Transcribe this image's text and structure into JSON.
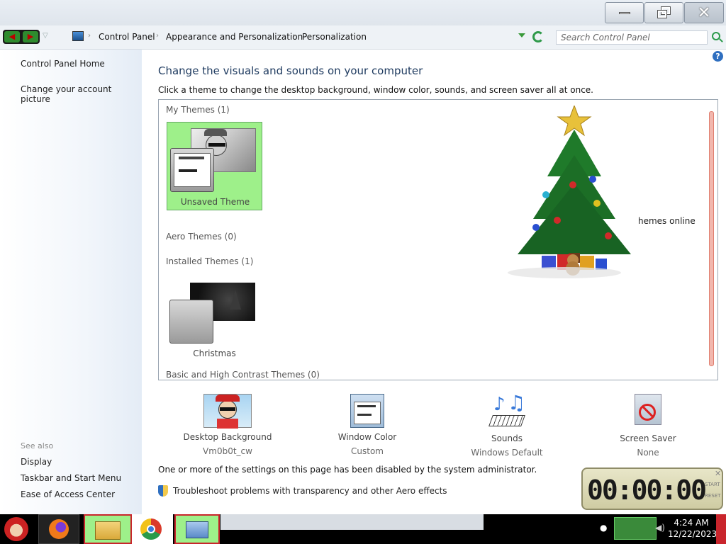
{
  "window": {
    "buttons": {
      "minimize": "minimize",
      "maximize": "restore",
      "close": "close"
    }
  },
  "address": {
    "breadcrumbs": [
      "Control Panel",
      "Appearance and Personalization",
      "Personalization"
    ],
    "search_placeholder": "Search Control Panel"
  },
  "sidebar": {
    "home": "Control Panel Home",
    "account_picture": "Change your account picture",
    "see_also_label": "See also",
    "see_also": [
      "Display",
      "Taskbar and Start Menu",
      "Ease of Access Center"
    ]
  },
  "main": {
    "title": "Change the visuals and sounds on your computer",
    "description": "Click a theme to change the desktop background, window color, sounds, and screen saver all at once.",
    "groups": {
      "my_themes": "My Themes (1)",
      "aero_themes": "Aero Themes (0)",
      "installed_themes": "Installed Themes (1)",
      "basic_themes": "Basic and High Contrast Themes (0)"
    },
    "themes": {
      "unsaved": "Unsaved Theme",
      "christmas": "Christmas"
    },
    "online_link": "hemes online",
    "settings": [
      {
        "label": "Desktop Background",
        "value": "Vm0b0t_cw"
      },
      {
        "label": "Window Color",
        "value": "Custom"
      },
      {
        "label": "Sounds",
        "value": "Windows Default"
      },
      {
        "label": "Screen Saver",
        "value": "None"
      }
    ],
    "disabled_note": "One or more of the settings on this page has been disabled by the system administrator.",
    "troubleshoot": "Troubleshoot problems with transparency and other Aero effects"
  },
  "gadget": {
    "time": "00:00:00",
    "side_top": "START",
    "side_bottom": "RESET"
  },
  "taskbar": {
    "time": "4:24 AM",
    "date": "12/22/2023"
  },
  "colors": {
    "selected_theme": "#9ef08a",
    "taskbar_accent": "#c9252c",
    "title_text": "#1e3a5f"
  }
}
